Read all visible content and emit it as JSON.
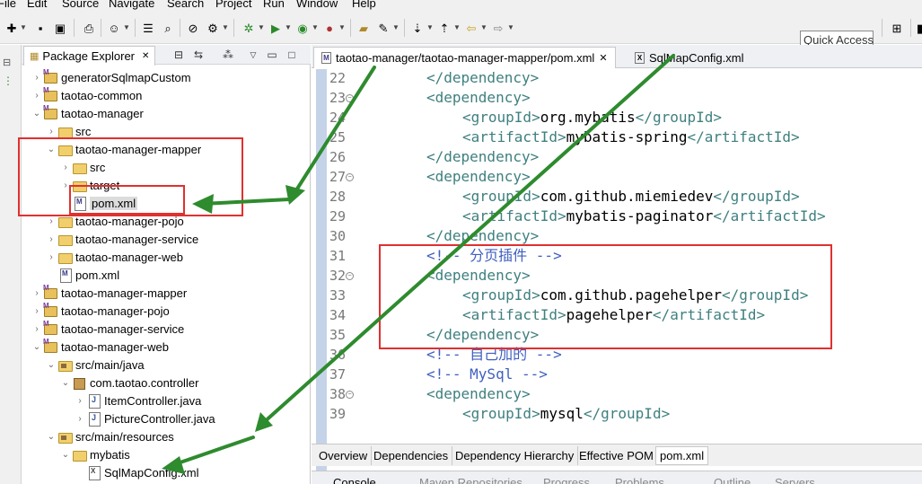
{
  "menu": [
    "File",
    "Edit",
    "Source",
    "Navigate",
    "Search",
    "Project",
    "Run",
    "Window",
    "Help"
  ],
  "toolbar": {
    "quick_access": "Quick Access",
    "icons": [
      "new-icon",
      "save-icon",
      "save-all-icon",
      "print-icon",
      "console-icon",
      "search-icon",
      "debug-icon",
      "run-icon",
      "open-type-icon",
      "back-icon",
      "forward-icon",
      "perspective-icon"
    ]
  },
  "package_explorer": {
    "title": "Package Explorer",
    "tree": [
      {
        "label": "generatorSqlmapCustom",
        "depth": 0,
        "twisty": "›",
        "icon": "project"
      },
      {
        "label": "taotao-common",
        "depth": 0,
        "twisty": "›",
        "icon": "project"
      },
      {
        "label": "taotao-manager",
        "depth": 0,
        "twisty": "⌄",
        "icon": "project"
      },
      {
        "label": "src",
        "depth": 1,
        "twisty": "›",
        "icon": "folder"
      },
      {
        "label": "taotao-manager-mapper",
        "depth": 1,
        "twisty": "⌄",
        "icon": "folder"
      },
      {
        "label": "src",
        "depth": 2,
        "twisty": "›",
        "icon": "folder"
      },
      {
        "label": "target",
        "depth": 2,
        "twisty": "›",
        "icon": "folder"
      },
      {
        "label": "pom.xml",
        "depth": 2,
        "twisty": "",
        "icon": "xml",
        "selected": true
      },
      {
        "label": "taotao-manager-pojo",
        "depth": 1,
        "twisty": "›",
        "icon": "folder"
      },
      {
        "label": "taotao-manager-service",
        "depth": 1,
        "twisty": "›",
        "icon": "folder"
      },
      {
        "label": "taotao-manager-web",
        "depth": 1,
        "twisty": "›",
        "icon": "folder"
      },
      {
        "label": "pom.xml",
        "depth": 1,
        "twisty": "",
        "icon": "xml"
      },
      {
        "label": "taotao-manager-mapper",
        "depth": 0,
        "twisty": "›",
        "icon": "project"
      },
      {
        "label": "taotao-manager-pojo",
        "depth": 0,
        "twisty": "›",
        "icon": "project"
      },
      {
        "label": "taotao-manager-service",
        "depth": 0,
        "twisty": "›",
        "icon": "project"
      },
      {
        "label": "taotao-manager-web",
        "depth": 0,
        "twisty": "⌄",
        "icon": "project"
      },
      {
        "label": "src/main/java",
        "depth": 1,
        "twisty": "⌄",
        "icon": "srcfolder"
      },
      {
        "label": "com.taotao.controller",
        "depth": 2,
        "twisty": "⌄",
        "icon": "package"
      },
      {
        "label": "ItemController.java",
        "depth": 3,
        "twisty": "›",
        "icon": "java"
      },
      {
        "label": "PictureController.java",
        "depth": 3,
        "twisty": "›",
        "icon": "java"
      },
      {
        "label": "src/main/resources",
        "depth": 1,
        "twisty": "⌄",
        "icon": "srcfolder"
      },
      {
        "label": "mybatis",
        "depth": 2,
        "twisty": "⌄",
        "icon": "folder"
      },
      {
        "label": "SqlMapConfig.xml",
        "depth": 3,
        "twisty": "",
        "icon": "xmlx"
      }
    ]
  },
  "editor": {
    "tabs": [
      {
        "label": "taotao-manager/taotao-manager-mapper/pom.xml",
        "active": true,
        "close": "✕"
      },
      {
        "label": "SqlMapConfig.xml",
        "active": false
      }
    ],
    "lines": [
      {
        "n": "22",
        "fold": false,
        "indent": 2,
        "parts": [
          {
            "t": "</dependency>",
            "c": "tg"
          }
        ]
      },
      {
        "n": "23",
        "fold": true,
        "indent": 2,
        "parts": [
          {
            "t": "<dependency>",
            "c": "tg"
          }
        ]
      },
      {
        "n": "24",
        "fold": false,
        "indent": 3,
        "parts": [
          {
            "t": "<groupId>",
            "c": "tg"
          },
          {
            "t": "org.mybatis",
            "c": "tx"
          },
          {
            "t": "</groupId>",
            "c": "tg"
          }
        ]
      },
      {
        "n": "25",
        "fold": false,
        "indent": 3,
        "parts": [
          {
            "t": "<artifactId>",
            "c": "tg"
          },
          {
            "t": "mybatis-spring",
            "c": "tx"
          },
          {
            "t": "</artifactId>",
            "c": "tg"
          }
        ]
      },
      {
        "n": "26",
        "fold": false,
        "indent": 2,
        "parts": [
          {
            "t": "</dependency>",
            "c": "tg"
          }
        ]
      },
      {
        "n": "27",
        "fold": true,
        "indent": 2,
        "parts": [
          {
            "t": "<dependency>",
            "c": "tg"
          }
        ]
      },
      {
        "n": "28",
        "fold": false,
        "indent": 3,
        "parts": [
          {
            "t": "<groupId>",
            "c": "tg"
          },
          {
            "t": "com.github.miemiedev",
            "c": "tx"
          },
          {
            "t": "</groupId>",
            "c": "tg"
          }
        ]
      },
      {
        "n": "29",
        "fold": false,
        "indent": 3,
        "parts": [
          {
            "t": "<artifactId>",
            "c": "tg"
          },
          {
            "t": "mybatis-paginator",
            "c": "tx"
          },
          {
            "t": "</artifactId>",
            "c": "tg"
          }
        ]
      },
      {
        "n": "30",
        "fold": false,
        "indent": 2,
        "parts": [
          {
            "t": "</dependency>",
            "c": "tg"
          }
        ]
      },
      {
        "n": "31",
        "fold": false,
        "indent": 2,
        "parts": [
          {
            "t": "<!-- 分页插件 -->",
            "c": "cm"
          }
        ]
      },
      {
        "n": "32",
        "fold": true,
        "indent": 2,
        "parts": [
          {
            "t": "<dependency>",
            "c": "tg"
          }
        ]
      },
      {
        "n": "33",
        "fold": false,
        "indent": 3,
        "parts": [
          {
            "t": "<groupId>",
            "c": "tg"
          },
          {
            "t": "com.github.pagehelper",
            "c": "tx"
          },
          {
            "t": "</groupId>",
            "c": "tg"
          }
        ]
      },
      {
        "n": "34",
        "fold": false,
        "indent": 3,
        "parts": [
          {
            "t": "<artifactId>",
            "c": "tg"
          },
          {
            "t": "pagehelper",
            "c": "tx"
          },
          {
            "t": "</artifactId>",
            "c": "tg"
          }
        ]
      },
      {
        "n": "35",
        "fold": false,
        "indent": 2,
        "parts": [
          {
            "t": "</dependency>",
            "c": "tg"
          }
        ]
      },
      {
        "n": "36",
        "fold": false,
        "indent": 2,
        "parts": [
          {
            "t": "<!-- 自己加的 -->",
            "c": "cm"
          }
        ]
      },
      {
        "n": "37",
        "fold": false,
        "indent": 2,
        "parts": [
          {
            "t": "<!-- MySql -->",
            "c": "cm"
          }
        ]
      },
      {
        "n": "38",
        "fold": true,
        "indent": 2,
        "parts": [
          {
            "t": "<dependency>",
            "c": "tg"
          }
        ]
      },
      {
        "n": "39",
        "fold": false,
        "indent": 3,
        "parts": [
          {
            "t": "<groupId>",
            "c": "tg"
          },
          {
            "t": "mysql",
            "c": "tx"
          },
          {
            "t": "</groupId>",
            "c": "tg"
          }
        ]
      }
    ],
    "bottom_tabs": [
      "Overview",
      "Dependencies",
      "Dependency Hierarchy",
      "Effective POM",
      "pom.xml"
    ],
    "active_bottom_tab": "pom.xml"
  },
  "console_tabs": [
    "Console",
    "Maven Repositories",
    "Progress",
    "Problems",
    "Outline",
    "Servers"
  ],
  "colors": {
    "tag": "#3f7f7f",
    "comment": "#3f5fbf",
    "annotation_box": "#e03030",
    "arrow": "#2e8b2e"
  }
}
